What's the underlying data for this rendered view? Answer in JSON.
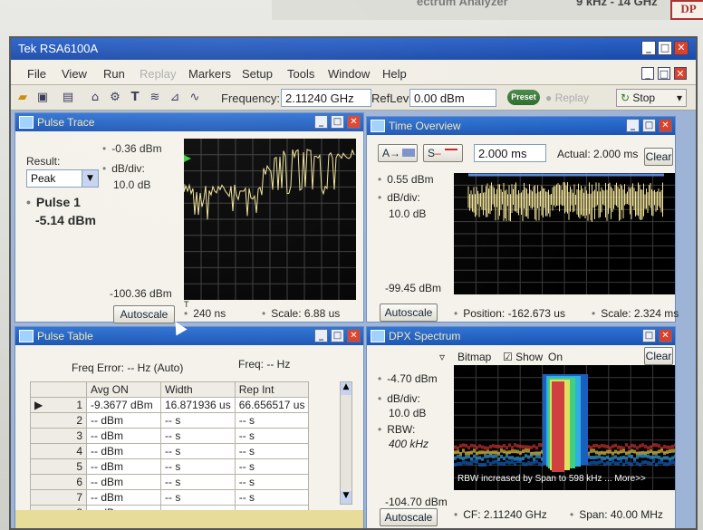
{
  "bezel": {
    "label_left": "ectrum Analyzer",
    "label_right": "9 kHz - 14 GHz",
    "logo": "DP"
  },
  "window": {
    "title": "Tek RSA6100A",
    "min": "_",
    "max": "□",
    "close": "✕"
  },
  "menu": [
    "File",
    "View",
    "Run",
    "Replay",
    "Markers",
    "Setup",
    "Tools",
    "Window",
    "Help"
  ],
  "toolbar": {
    "frequency_label": "Frequency:",
    "frequency_value": "2.11240 GHz",
    "reflev_label": "RefLev:",
    "reflev_value": "0.00 dBm",
    "preset": "Preset",
    "replay": "Replay",
    "stop": "Stop"
  },
  "pulse_trace": {
    "title": "Pulse Trace",
    "result_label": "Result:",
    "result_value": "Peak",
    "pulse_label": "Pulse 1",
    "pulse_value": "-5.14 dBm",
    "top": "-0.36 dBm",
    "div_label": "dB/div:",
    "div_value": "10.0 dB",
    "bottom": "-100.36 dBm",
    "autoscale": "Autoscale",
    "time": "240 ns",
    "scale": "Scale: 6.88 us",
    "marker_t": "T"
  },
  "time_overview": {
    "title": "Time Overview",
    "btn_a": "A",
    "btn_s": "S",
    "duration": "2.000 ms",
    "actual": "Actual: 2.000 ms",
    "clear": "Clear",
    "top": "0.55 dBm",
    "div_label": "dB/div:",
    "div_value": "10.0 dB",
    "bottom": "-99.45 dBm",
    "autoscale": "Autoscale",
    "position": "Position: -162.673 us",
    "scale": "Scale: 2.324 ms"
  },
  "pulse_table": {
    "title": "Pulse Table",
    "freq_error": "Freq Error: -- Hz (Auto)",
    "freq": "Freq: -- Hz",
    "headers": [
      "",
      "Avg ON",
      "Width",
      "Rep Int"
    ],
    "rows": [
      {
        "n": "1",
        "avg": "-9.3677 dBm",
        "width": "16.871936 us",
        "rep": "66.656517 us"
      },
      {
        "n": "2",
        "avg": "-- dBm",
        "width": "-- s",
        "rep": "-- s"
      },
      {
        "n": "3",
        "avg": "-- dBm",
        "width": "-- s",
        "rep": "-- s"
      },
      {
        "n": "4",
        "avg": "-- dBm",
        "width": "-- s",
        "rep": "-- s"
      },
      {
        "n": "5",
        "avg": "-- dBm",
        "width": "-- s",
        "rep": "-- s"
      },
      {
        "n": "6",
        "avg": "-- dBm",
        "width": "-- s",
        "rep": "-- s"
      },
      {
        "n": "7",
        "avg": "-- dBm",
        "width": "-- s",
        "rep": "-- s"
      },
      {
        "n": "8",
        "avg": "-- dBm",
        "width": "-- s",
        "rep": "-- s"
      }
    ]
  },
  "dpx": {
    "title": "DPX Spectrum",
    "bitmap": "Bitmap",
    "show": "Show",
    "on": "On",
    "clear": "Clear",
    "top": "-4.70 dBm",
    "div_label": "dB/div:",
    "div_value": "10.0 dB",
    "rbw_label": "RBW:",
    "rbw_value": "400 kHz",
    "bottom": "-104.70 dBm",
    "note": "RBW increased by Span to 598 kHz ... More>>",
    "autoscale": "Autoscale",
    "cf": "CF: 2.11240 GHz",
    "span": "Span: 40.00 MHz"
  },
  "colors": {
    "trace": "#f2e49a",
    "title_bar": "#1a55b4",
    "grid": "#3a3a3a"
  }
}
